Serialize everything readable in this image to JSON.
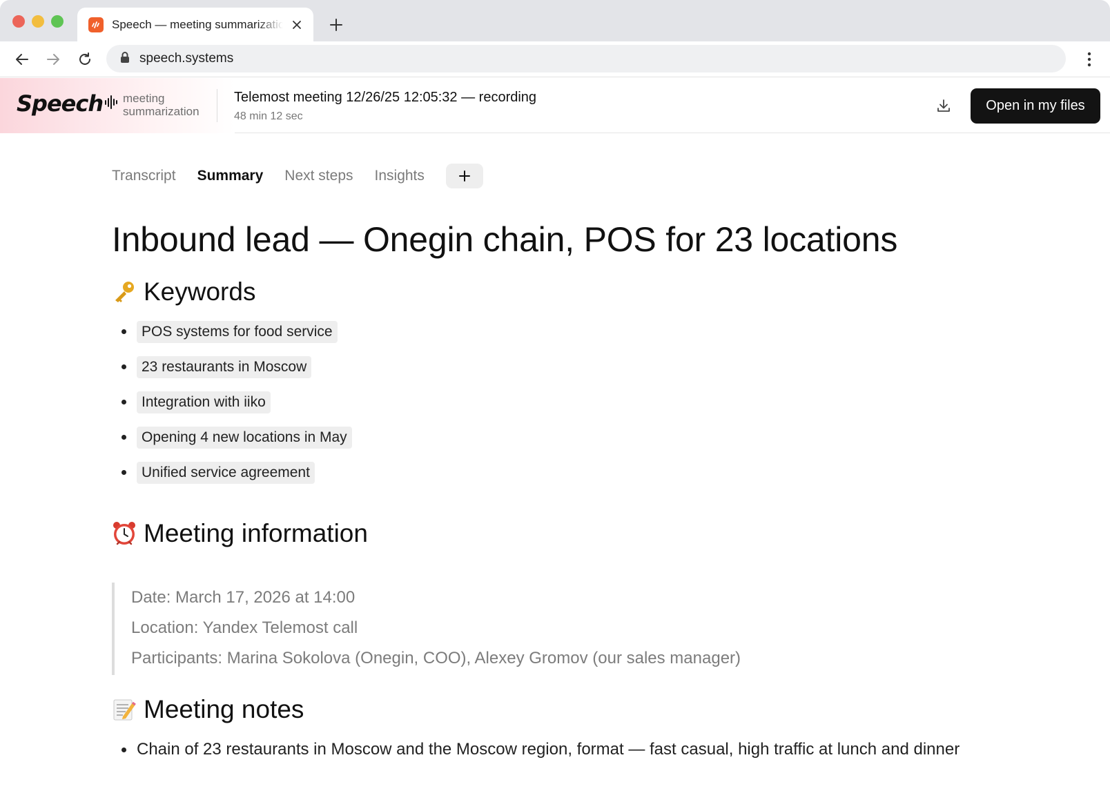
{
  "browser": {
    "tab_title": "Speech — meeting summarization",
    "url": "speech.systems"
  },
  "header": {
    "logo_text": "Speech",
    "brand_sub_line1": "meeting",
    "brand_sub_line2": "summarization",
    "recording_title": "Telemost meeting 12/26/25 12:05:32 — recording",
    "recording_duration": "48 min 12 sec",
    "open_button_label": "Open in my files"
  },
  "doc_tabs": [
    {
      "label": "Transcript",
      "active": false
    },
    {
      "label": "Summary",
      "active": true
    },
    {
      "label": "Next steps",
      "active": false
    },
    {
      "label": "Insights",
      "active": false
    }
  ],
  "document": {
    "title": "Inbound lead — Onegin chain, POS for 23 locations",
    "keywords_heading": "Keywords",
    "keywords": [
      "POS systems for food service",
      "23 restaurants in Moscow",
      "Integration with iiko",
      "Opening 4 new locations in May",
      "Unified service agreement"
    ],
    "meeting_info_heading": "Meeting information",
    "meeting_info": [
      "Date: March 17, 2026 at 14:00",
      "Location: Yandex Telemost call",
      "Participants: Marina Sokolova (Onegin, COO), Alexey Gromov (our sales manager)"
    ],
    "notes_heading": "Meeting notes",
    "notes": [
      "Chain of 23 restaurants in Moscow and the Moscow region, format — fast casual, high traffic at lunch and dinner"
    ]
  },
  "colors": {
    "accent_button": "#131313",
    "favicon": "#f0602b",
    "chip_bg": "#eeeeee"
  },
  "icons": {
    "key": "key-icon",
    "clock": "alarm-clock-icon",
    "notes": "memo-icon"
  }
}
